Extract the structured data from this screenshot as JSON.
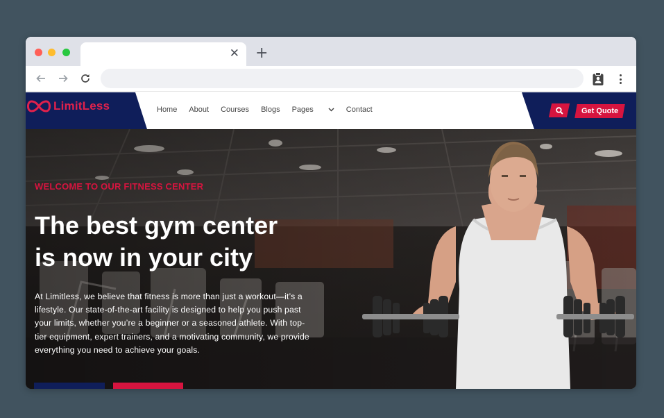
{
  "browser": {
    "tab_title": "",
    "tab_close_icon": "close-icon",
    "new_tab_label": "+",
    "address": "",
    "icons": [
      "arrow-left-icon",
      "arrow-right-icon",
      "reload-icon",
      "clipboard-icon",
      "more-vert-icon"
    ]
  },
  "site": {
    "logo_text": "LimitLess",
    "nav": [
      "Home",
      "About",
      "Courses",
      "Blogs",
      "Pages",
      "Contact"
    ],
    "cta_quote": "Get Quote",
    "hero": {
      "kicker": "WELCOME TO OUR FITNESS CENTER",
      "headline_line1": "The best gym center",
      "headline_line2": "is now in your city",
      "description": "At Limitless, we believe that fitness is more than just a workout—it’s a lifestyle. Our state-of-the-art facility is designed to help you push past your limits, whether you’re a beginner or a seasoned athlete. With top-tier equipment, expert trainers, and a motivating community, we provide everything you need to achieve your goals."
    }
  },
  "colors": {
    "background": "#41535f",
    "brand_navy": "#0f1e5a",
    "brand_red": "#d6143f"
  }
}
